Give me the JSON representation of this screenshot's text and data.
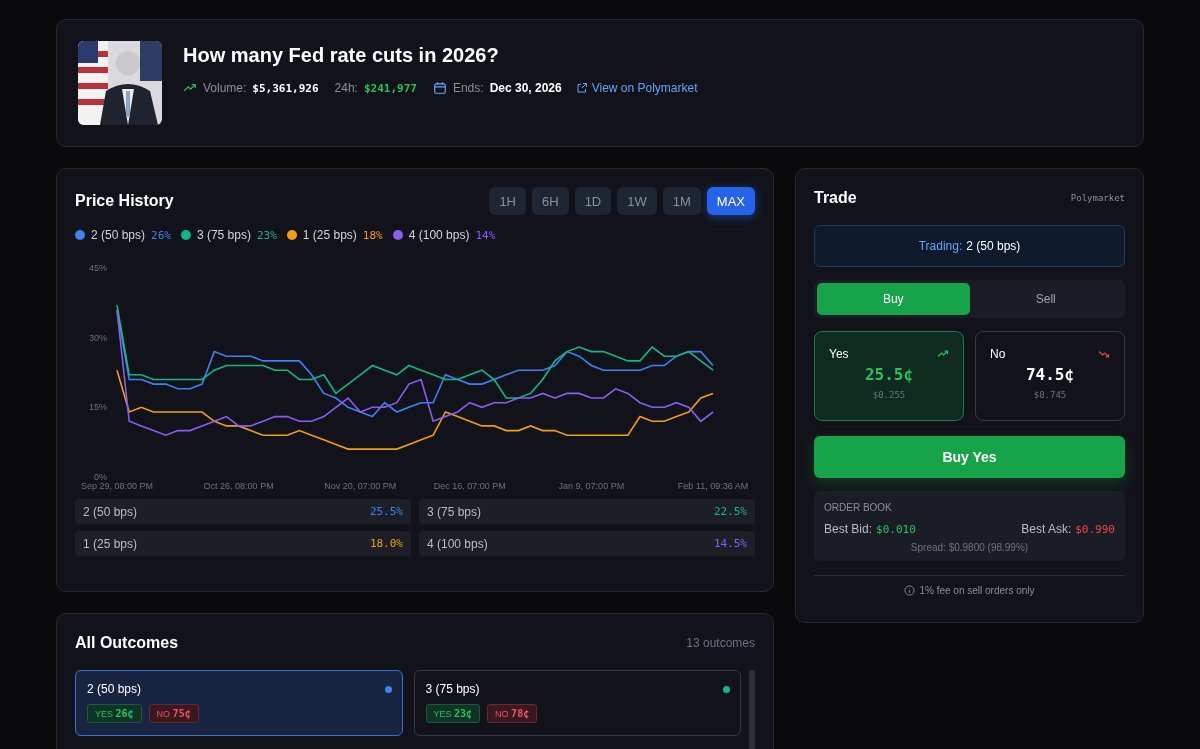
{
  "market": {
    "title": "How many Fed rate cuts in 2026?",
    "volume_label": "Volume:",
    "volume": "$5,361,926",
    "day_label": "24h:",
    "day_volume": "$241,977",
    "ends_label": "Ends:",
    "ends": "Dec 30, 2026",
    "link": "View on Polymarket"
  },
  "price_history": {
    "title": "Price History",
    "timeframes": [
      {
        "label": "1H",
        "selected": false
      },
      {
        "label": "6H",
        "selected": false
      },
      {
        "label": "1D",
        "selected": false
      },
      {
        "label": "1W",
        "selected": false
      },
      {
        "label": "1M",
        "selected": false
      },
      {
        "label": "MAX",
        "selected": true
      }
    ],
    "legend_values": [
      "26%",
      "23%",
      "18%",
      "14%"
    ],
    "chart_data": {
      "type": "line",
      "ylim": [
        0,
        45
      ],
      "yticks": [
        {
          "value": 0,
          "label": "0%"
        },
        {
          "value": 15,
          "label": "15%"
        },
        {
          "value": 30,
          "label": "30%"
        },
        {
          "value": 45,
          "label": "45%"
        }
      ],
      "categories": [
        "Sep 29, 08:00 PM",
        null,
        null,
        null,
        null,
        null,
        null,
        null,
        null,
        null,
        "Oct 26, 08:00 PM",
        null,
        null,
        null,
        null,
        null,
        null,
        null,
        null,
        null,
        "Nov 20, 07:00 PM",
        null,
        null,
        null,
        null,
        null,
        null,
        null,
        null,
        "Dec 16, 07:00 PM",
        null,
        null,
        null,
        null,
        null,
        null,
        null,
        null,
        null,
        "Jan 9, 07:00 PM",
        null,
        null,
        null,
        null,
        null,
        null,
        null,
        null,
        null,
        "Feb 11, 09:36 AM"
      ],
      "series": [
        {
          "name": "2 (50 bps)",
          "color": "#3b82f6",
          "values": [
            36,
            21,
            21,
            20,
            20,
            19,
            19,
            20,
            27,
            26,
            26,
            26,
            25,
            25,
            25,
            25,
            22,
            18,
            17,
            15,
            14,
            13,
            16,
            14,
            15,
            16,
            16,
            22,
            21,
            20,
            20,
            21,
            22,
            23,
            23,
            23,
            24,
            27,
            26,
            24,
            23,
            23,
            23,
            23,
            24,
            24,
            26,
            27,
            27,
            24
          ]
        },
        {
          "name": "3 (75 bps)",
          "color": "#10b981",
          "values": [
            37,
            22,
            22,
            21,
            21,
            21,
            21,
            21,
            23,
            24,
            24,
            24,
            24,
            23,
            23,
            21,
            21,
            22,
            18,
            20,
            22,
            24,
            23,
            22,
            24,
            23,
            22,
            21,
            21,
            22,
            23,
            21,
            17,
            17,
            18,
            21,
            25,
            27,
            28,
            27,
            27,
            26,
            25,
            25,
            28,
            26,
            26,
            27,
            25,
            23
          ]
        },
        {
          "name": "1 (25 bps)",
          "color": "#f59e0b",
          "values": [
            23,
            14,
            15,
            14,
            14,
            14,
            14,
            14,
            12,
            11,
            11,
            10,
            9,
            9,
            9,
            10,
            9,
            8,
            7,
            6,
            6,
            6,
            6,
            6,
            7,
            8,
            9,
            14,
            13,
            12,
            11,
            11,
            10,
            10,
            11,
            10,
            10,
            9,
            9,
            9,
            9,
            9,
            9,
            13,
            12,
            12,
            13,
            14,
            17,
            18
          ]
        },
        {
          "name": "4 (100 bps)",
          "color": "#8b5cf6",
          "values": [
            36,
            12,
            11,
            10,
            9,
            10,
            10,
            11,
            12,
            13,
            11,
            11,
            12,
            13,
            13,
            12,
            12,
            13,
            15,
            17,
            14,
            15,
            15,
            16,
            20,
            21,
            12,
            13,
            14,
            16,
            15,
            16,
            16,
            17,
            17,
            18,
            17,
            18,
            18,
            17,
            17,
            19,
            18,
            16,
            15,
            15,
            16,
            15,
            12,
            14
          ]
        }
      ]
    },
    "summary": [
      {
        "name": "2 (50 bps)",
        "value": "25.5%",
        "color": "#3b82f6"
      },
      {
        "name": "3 (75 bps)",
        "value": "22.5%",
        "color": "#10b981"
      },
      {
        "name": "1 (25 bps)",
        "value": "18.0%",
        "color": "#f59e0b"
      },
      {
        "name": "4 (100 bps)",
        "value": "14.5%",
        "color": "#8b5cf6"
      }
    ]
  },
  "outcomes": {
    "title": "All Outcomes",
    "count": "13 outcomes",
    "items": [
      {
        "name": "2 (50 bps)",
        "selected": true,
        "color": "#3b82f6",
        "yes_label": "YES",
        "yes": "26¢",
        "no_label": "NO",
        "no": "75¢"
      },
      {
        "name": "3 (75 bps)",
        "selected": false,
        "color": "#10b981",
        "yes_label": "YES",
        "yes": "23¢",
        "no_label": "NO",
        "no": "78¢"
      }
    ]
  },
  "trade": {
    "title": "Trade",
    "source": "Polymarket",
    "trading_label": "Trading:",
    "trading": "2 (50 bps)",
    "sides": [
      {
        "label": "Buy",
        "selected": true
      },
      {
        "label": "Sell",
        "selected": false
      }
    ],
    "options": [
      {
        "label": "Yes",
        "kind": "up",
        "price": "25.5¢",
        "dollars": "$0.255",
        "selected": true
      },
      {
        "label": "No",
        "kind": "down",
        "price": "74.5¢",
        "dollars": "$0.745",
        "selected": false
      }
    ],
    "action": "Buy Yes",
    "order_book": {
      "title": "ORDER BOOK",
      "bid_label": "Best Bid:",
      "bid": "$0.010",
      "ask_label": "Best Ask:",
      "ask": "$0.990",
      "spread": "Spread: $0.9800 (98.99%)"
    },
    "fee_note": "1% fee on sell orders only"
  }
}
